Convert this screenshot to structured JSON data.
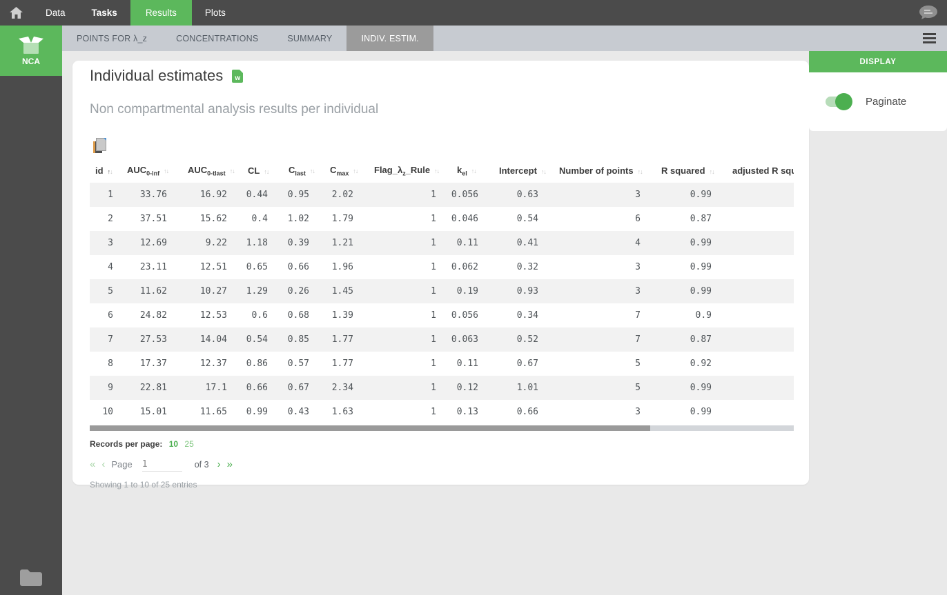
{
  "topnav": {
    "tabs": [
      {
        "label": "Data"
      },
      {
        "label": "Tasks"
      },
      {
        "label": "Results"
      },
      {
        "label": "Plots"
      }
    ],
    "active_tab": "Results"
  },
  "subnav": {
    "tabs": [
      {
        "label": "POINTS FOR λ_z"
      },
      {
        "label": "CONCENTRATIONS"
      },
      {
        "label": "SUMMARY"
      },
      {
        "label": "INDIV. ESTIM."
      }
    ],
    "active_tab": "INDIV. ESTIM."
  },
  "sidebar": {
    "project_label": "NCA"
  },
  "main": {
    "title": "Individual estimates",
    "word_icon_letter": "w",
    "subtitle": "Non compartmental analysis results per individual",
    "table": {
      "columns": [
        {
          "pre": "id",
          "sort": "asc"
        },
        {
          "pre": "AUC",
          "sub": "0-inf"
        },
        {
          "pre": "AUC",
          "sub": "0-tlast"
        },
        {
          "pre": "CL"
        },
        {
          "pre": "C",
          "sub": "last"
        },
        {
          "pre": "C",
          "sub": "max"
        },
        {
          "pre": "Flag_λ",
          "sub": "z",
          "post": "_Rule"
        },
        {
          "pre": "k",
          "sub": "el"
        },
        {
          "pre": "Intercept"
        },
        {
          "pre": "Number of points"
        },
        {
          "pre": "R squared"
        },
        {
          "pre": "adjusted R squ",
          "clipped": true
        }
      ],
      "rows": [
        [
          "1",
          "33.76",
          "16.92",
          "0.44",
          "0.95",
          "2.02",
          "1",
          "0.056",
          "0.63",
          "3",
          "0.99",
          ""
        ],
        [
          "2",
          "37.51",
          "15.62",
          "0.4",
          "1.02",
          "1.79",
          "1",
          "0.046",
          "0.54",
          "6",
          "0.87",
          ""
        ],
        [
          "3",
          "12.69",
          "9.22",
          "1.18",
          "0.39",
          "1.21",
          "1",
          "0.11",
          "0.41",
          "4",
          "0.99",
          ""
        ],
        [
          "4",
          "23.11",
          "12.51",
          "0.65",
          "0.66",
          "1.96",
          "1",
          "0.062",
          "0.32",
          "3",
          "0.99",
          ""
        ],
        [
          "5",
          "11.62",
          "10.27",
          "1.29",
          "0.26",
          "1.45",
          "1",
          "0.19",
          "0.93",
          "3",
          "0.99",
          ""
        ],
        [
          "6",
          "24.82",
          "12.53",
          "0.6",
          "0.68",
          "1.39",
          "1",
          "0.056",
          "0.34",
          "7",
          "0.9",
          ""
        ],
        [
          "7",
          "27.53",
          "14.04",
          "0.54",
          "0.85",
          "1.77",
          "1",
          "0.063",
          "0.52",
          "7",
          "0.87",
          ""
        ],
        [
          "8",
          "17.37",
          "12.37",
          "0.86",
          "0.57",
          "1.77",
          "1",
          "0.11",
          "0.67",
          "5",
          "0.92",
          ""
        ],
        [
          "9",
          "22.81",
          "17.1",
          "0.66",
          "0.67",
          "2.34",
          "1",
          "0.12",
          "1.01",
          "5",
          "0.99",
          ""
        ],
        [
          "10",
          "15.01",
          "11.65",
          "0.99",
          "0.43",
          "1.63",
          "1",
          "0.13",
          "0.66",
          "3",
          "0.99",
          ""
        ]
      ]
    },
    "pagination": {
      "records_label": "Records per page:",
      "options": [
        "10",
        "25"
      ],
      "selected_option": "10",
      "icons": {
        "first": "«",
        "prev": "‹",
        "next": "›",
        "last": "»"
      },
      "page_label": "Page",
      "page_value": "1",
      "of_label": "of 3",
      "showing": "Showing 1 to 10 of 25 entries"
    }
  },
  "display_panel": {
    "header": "DISPLAY",
    "toggle_label": "Paginate",
    "toggle_on": true
  },
  "colors": {
    "accent_green": "#5cb85c",
    "toggle_green": "#4caf50",
    "nav_dark": "#4b4b4b",
    "subnav_gray": "#c7cbd1",
    "active_subtab_gray": "#9b9b9b",
    "row_alt": "#f2f2f2"
  }
}
